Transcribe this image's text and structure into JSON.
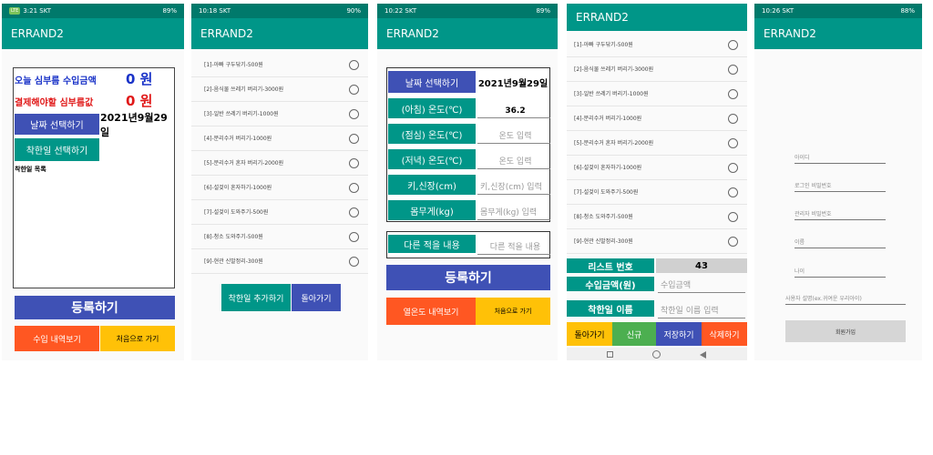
{
  "app_title": "ERRAND2",
  "colors": {
    "status_bar": "#00796b",
    "app_bar": "#009688",
    "blue": "#3f51b5",
    "orange": "#ff5722",
    "amber": "#ffc107"
  },
  "screen1": {
    "time": "3:21 SKT",
    "battery": "89%",
    "today_income_label": "오늘 심부름 수입금액",
    "today_income_value": "0 원",
    "pay_label": "결제해야할 심부름값",
    "pay_value": "0 원",
    "date_button": "날짜 선택하기",
    "date_value": "2021년9월29일",
    "good_day_button": "착한일 선택하기",
    "good_day_list_label": "착한일 목록",
    "register_button": "등록하기",
    "income_history_button": "수입 내역보기",
    "home_button": "처음으로 가기"
  },
  "screen2": {
    "time": "10:18 SKT",
    "battery": "90%",
    "items": [
      "[1]-아빠 구두닦기-500원",
      "[2]-음식물 쓰레기 버리기-3000원",
      "[3]-일반 쓰레기 버리기-1000원",
      "[4]-분리수거 버리기-1000원",
      "[5]-분리수거 혼자 버리기-2000원",
      "[6]-설겆이 혼자하기-1000원",
      "[7]-설겆이 도와주기-500원",
      "[8]-청소 도와주기-500원",
      "[9]-현관 신발정리-300원"
    ],
    "add_button": "착한일 추가하기",
    "back_button": "돌아가기"
  },
  "screen3": {
    "time": "10:22 SKT",
    "battery": "89%",
    "date_button": "날짜 선택하기",
    "date_value": "2021년9월29일",
    "rows": [
      {
        "label": "(아침) 온도(℃)",
        "value": "36.2",
        "filled": true
      },
      {
        "label": "(점심) 온도(℃)",
        "value": "온도 입력",
        "filled": false
      },
      {
        "label": "(저녁) 온도(℃)",
        "value": "온도 입력",
        "filled": false
      },
      {
        "label": "키,신장(cm)",
        "value": "키,신장(cm) 입력",
        "filled": false
      },
      {
        "label": "몸무게(kg)",
        "value": "몸무게(kg) 입력",
        "filled": false
      }
    ],
    "other_label": "다른 적을 내용",
    "other_placeholder": "다른 적을 내용",
    "register_button": "등록하기",
    "fever_history_button": "열온도 내역보기",
    "home_button": "처음으로 가기"
  },
  "screen4": {
    "items": [
      "[1]-아빠 구두닦기-500원",
      "[2]-음식물 쓰레기 버리기-3000원",
      "[3]-일반 쓰레기 버리기-1000원",
      "[4]-분리수거 버리기-1000원",
      "[5]-분리수거 혼자 버리기-2000원",
      "[6]-설겆이 혼자하기-1000원",
      "[7]-설겆이 도와주기-500원",
      "[8]-청소 도와주기-500원",
      "[9]-현관 신발정리-300원"
    ],
    "list_number_label": "리스트 번호",
    "list_number_value": "43",
    "income_label": "수입금액(원)",
    "income_placeholder": "수입금액",
    "name_label": "착한일 이름",
    "name_placeholder": "착한일 이름 입력",
    "back_button": "돌아가기",
    "new_button": "신규",
    "save_button": "저장하기",
    "delete_button": "삭제하기"
  },
  "screen5": {
    "time": "10:26 SKT",
    "battery": "88%",
    "id_placeholder": "아이디",
    "password_placeholder": "로그인 비밀번호",
    "admin_password_placeholder": "관리자 비밀번호",
    "name_placeholder": "이름",
    "age_placeholder": "나이",
    "description_placeholder": "사용자 설명(ex.귀여운 우리아이)",
    "signup_button": "회원가입"
  }
}
